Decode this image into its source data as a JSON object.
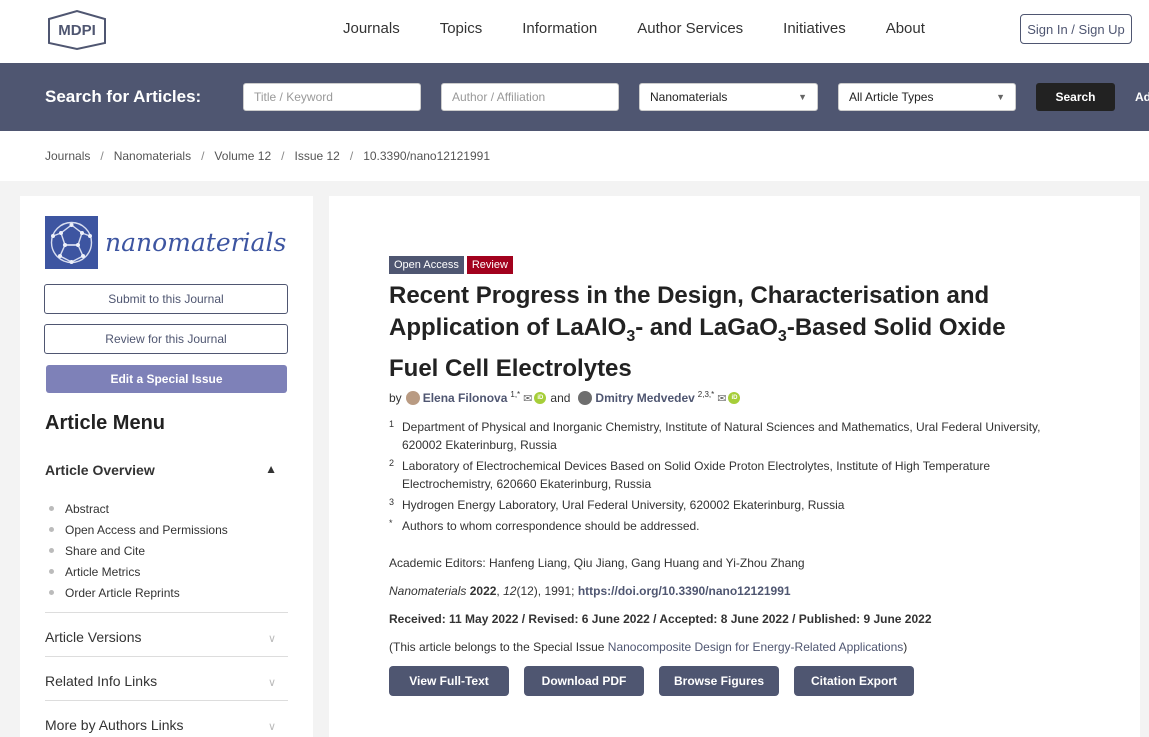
{
  "header": {
    "logo": "MDPI",
    "nav": [
      "Journals",
      "Topics",
      "Information",
      "Author Services",
      "Initiatives",
      "About"
    ],
    "signin": "Sign In / Sign Up"
  },
  "search": {
    "label": "Search for Articles:",
    "title_placeholder": "Title / Keyword",
    "author_placeholder": "Author / Affiliation",
    "journal_selected": "Nanomaterials",
    "type_selected": "All Article Types",
    "button": "Search",
    "advanced": "Advanced"
  },
  "breadcrumb": [
    "Journals",
    "Nanomaterials",
    "Volume 12",
    "Issue 12",
    "10.3390/nano12121991"
  ],
  "sidebar": {
    "journal_name": "nanomaterials",
    "submit": "Submit to this Journal",
    "review": "Review for this Journal",
    "special": "Edit a Special Issue",
    "menu_title": "Article Menu",
    "overview": "Article Overview",
    "items": [
      "Abstract",
      "Open Access and Permissions",
      "Share and Cite",
      "Article Metrics",
      "Order Article Reprints"
    ],
    "sections": [
      "Article Versions",
      "Related Info Links",
      "More by Authors Links"
    ]
  },
  "article": {
    "badge_oa": "Open Access",
    "badge_type": "Review",
    "title_1": "Recent Progress in the Design, Characterisation and",
    "title_2a": "Application of LaAlO",
    "title_sub1": "3",
    "title_2b": "- and LaGaO",
    "title_sub2": "3",
    "title_2c": "-Based Solid Oxide",
    "title_3": "Fuel Cell Electrolytes",
    "by": "by",
    "author1": "Elena Filonova",
    "author1_sup": "1,*",
    "and": "and",
    "author2": "Dmitry Medvedev",
    "author2_sup": "2,3,*",
    "affiliations": [
      {
        "num": "1",
        "text": "Department of Physical and Inorganic Chemistry, Institute of Natural Sciences and Mathematics, Ural Federal University, 620002 Ekaterinburg, Russia"
      },
      {
        "num": "2",
        "text": "Laboratory of Electrochemical Devices Based on Solid Oxide Proton Electrolytes, Institute of High Temperature Electrochemistry, 620660 Ekaterinburg, Russia"
      },
      {
        "num": "3",
        "text": "Hydrogen Energy Laboratory, Ural Federal University, 620002 Ekaterinburg, Russia"
      },
      {
        "num": "*",
        "text": "Authors to whom correspondence should be addressed."
      }
    ],
    "editors": "Academic Editors: Hanfeng Liang, Qiu Jiang, Gang Huang and Yi-Zhou Zhang",
    "cite_journal": "Nanomaterials",
    "cite_year": "2022",
    "cite_mid": ", ",
    "cite_volume": "12",
    "cite_rest": "(12), 1991; ",
    "doi": "https://doi.org/10.3390/nano12121991",
    "dates": "Received: 11 May 2022 / Revised: 6 June 2022 / Accepted: 8 June 2022 / Published: 9 June 2022",
    "special_prefix": "(This article belongs to the Special Issue ",
    "special_name": "Nanocomposite Design for Energy-Related Applications",
    "special_suffix": ")",
    "buttons": [
      "View Full-Text",
      "Download PDF",
      "Browse Figures",
      "Citation Export"
    ]
  }
}
